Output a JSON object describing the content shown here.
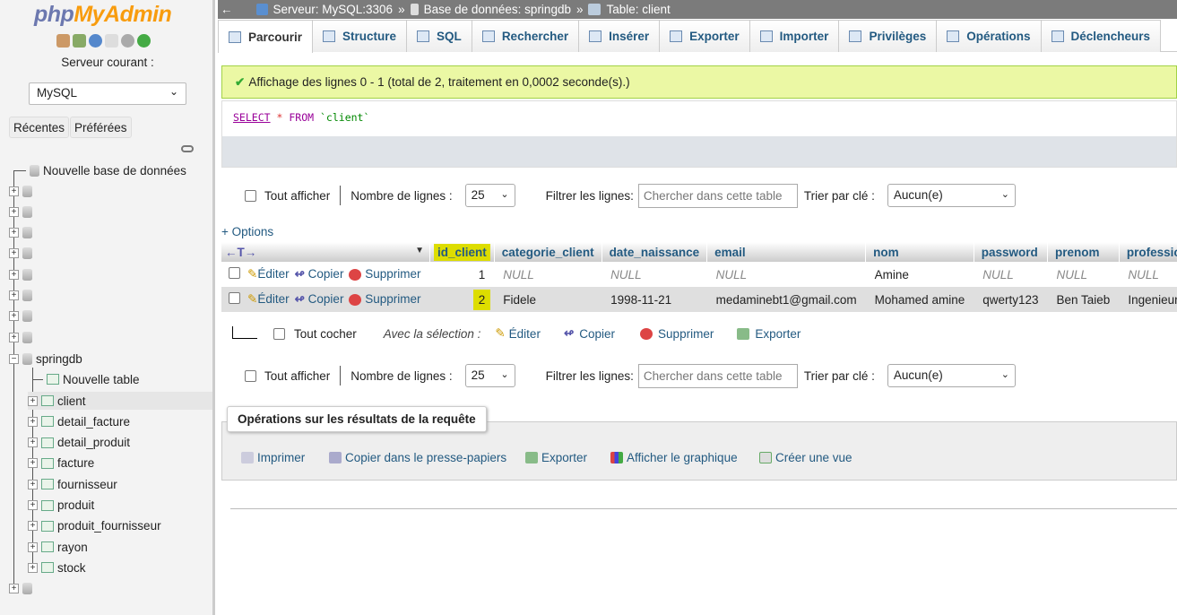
{
  "sidebar": {
    "logo_a": "php",
    "logo_b": "MyAdmin",
    "server_label": "Serveur courant :",
    "server_value": "MySQL",
    "recent": "Récentes",
    "favorites": "Préférées",
    "new_db": "Nouvelle base de données",
    "db_name": "springdb",
    "new_table": "Nouvelle table",
    "tables": [
      "client",
      "detail_facture",
      "detail_produit",
      "facture",
      "fournisseur",
      "produit",
      "produit_fournisseur",
      "rayon",
      "stock"
    ]
  },
  "breadcrumb": {
    "server": "Serveur: MySQL:3306",
    "db": "Base de données: springdb",
    "table": "Table: client",
    "sep": "»"
  },
  "tabs": [
    "Parcourir",
    "Structure",
    "SQL",
    "Rechercher",
    "Insérer",
    "Exporter",
    "Importer",
    "Privilèges",
    "Opérations",
    "Déclencheurs"
  ],
  "message": "Affichage des lignes 0 - 1 (total de 2, traitement en 0,0002 seconde(s).)",
  "sql": {
    "kw1": "SELECT",
    "star": "*",
    "kw2": "FROM",
    "table": "`client`"
  },
  "nav": {
    "show_all": "Tout afficher",
    "rows_label": "Nombre de lignes :",
    "rows_value": "25",
    "filter_label": "Filtrer les lignes:",
    "filter_placeholder": "Chercher dans cette table",
    "sort_label": "Trier par clé :",
    "sort_value": "Aucun(e)"
  },
  "options": "+ Options",
  "columns": [
    "id_client",
    "categorie_client",
    "date_naissance",
    "email",
    "nom",
    "password",
    "prenom",
    "profession"
  ],
  "row_actions": {
    "edit": "Éditer",
    "copy": "Copier",
    "delete": "Supprimer"
  },
  "rows": [
    [
      "1",
      "NULL",
      "NULL",
      "NULL",
      "Amine",
      "NULL",
      "NULL",
      "NULL"
    ],
    [
      "2",
      "Fidele",
      "1998-11-21",
      "medaminebt1@gmail.com",
      "Mohamed amine",
      "qwerty123",
      "Ben Taieb",
      "Ingenieur"
    ]
  ],
  "bulk": {
    "check_all": "Tout cocher",
    "with_selection": "Avec la sélection :",
    "edit": "Éditer",
    "copy": "Copier",
    "delete": "Supprimer",
    "export": "Exporter"
  },
  "query_ops": {
    "title": "Opérations sur les résultats de la requête",
    "print": "Imprimer",
    "copy_clipboard": "Copier dans le presse-papiers",
    "export": "Exporter",
    "chart": "Afficher le graphique",
    "create_view": "Créer une vue"
  }
}
